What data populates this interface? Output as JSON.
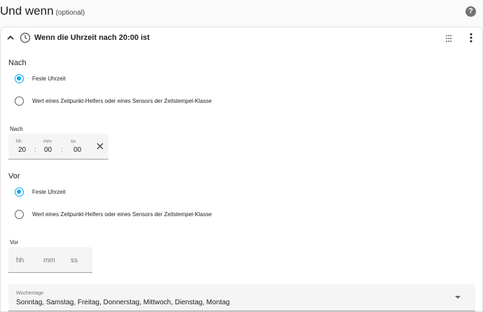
{
  "header": {
    "title": "Und wenn",
    "optional": "(optional)",
    "help_icon": "help-icon",
    "help_glyph": "?"
  },
  "condition": {
    "title": "Wenn die Uhrzeit nach 20:00 ist",
    "icons": {
      "collapse": "chevron-up-icon",
      "type": "clock-icon",
      "drag": "drag-handle-icon",
      "menu": "more-vertical-icon"
    }
  },
  "after": {
    "section_label": "Nach",
    "options": [
      {
        "label": "Feste Uhrzeit",
        "checked": true
      },
      {
        "label": "Wert eines Zeitpunkt-Helfers oder eines Sensors der Zeitstempel-Klasse",
        "checked": false
      }
    ],
    "time": {
      "label": "Nach",
      "hh_label": "hh",
      "mm_label": "mm",
      "ss_label": "ss",
      "hh": "20",
      "mm": "00",
      "ss": "00",
      "separator": ":"
    }
  },
  "before": {
    "section_label": "Vor",
    "options": [
      {
        "label": "Feste Uhrzeit",
        "checked": true
      },
      {
        "label": "Wert eines Zeitpunkt-Helfers oder eines Sensors der Zeitstempel-Klasse",
        "checked": false
      }
    ],
    "time": {
      "label": "Vor",
      "hh_placeholder": "hh",
      "mm_placeholder": "mm",
      "ss_placeholder": "ss"
    }
  },
  "weekdays": {
    "label": "Wochentage",
    "value": "Sonntag, Samstag, Freitag, Donnerstag, Mittwoch, Dienstag, Montag"
  },
  "colors": {
    "accent": "#03a9f4",
    "text": "#212121",
    "secondary": "#757575",
    "field_bg": "#f5f5f5"
  }
}
